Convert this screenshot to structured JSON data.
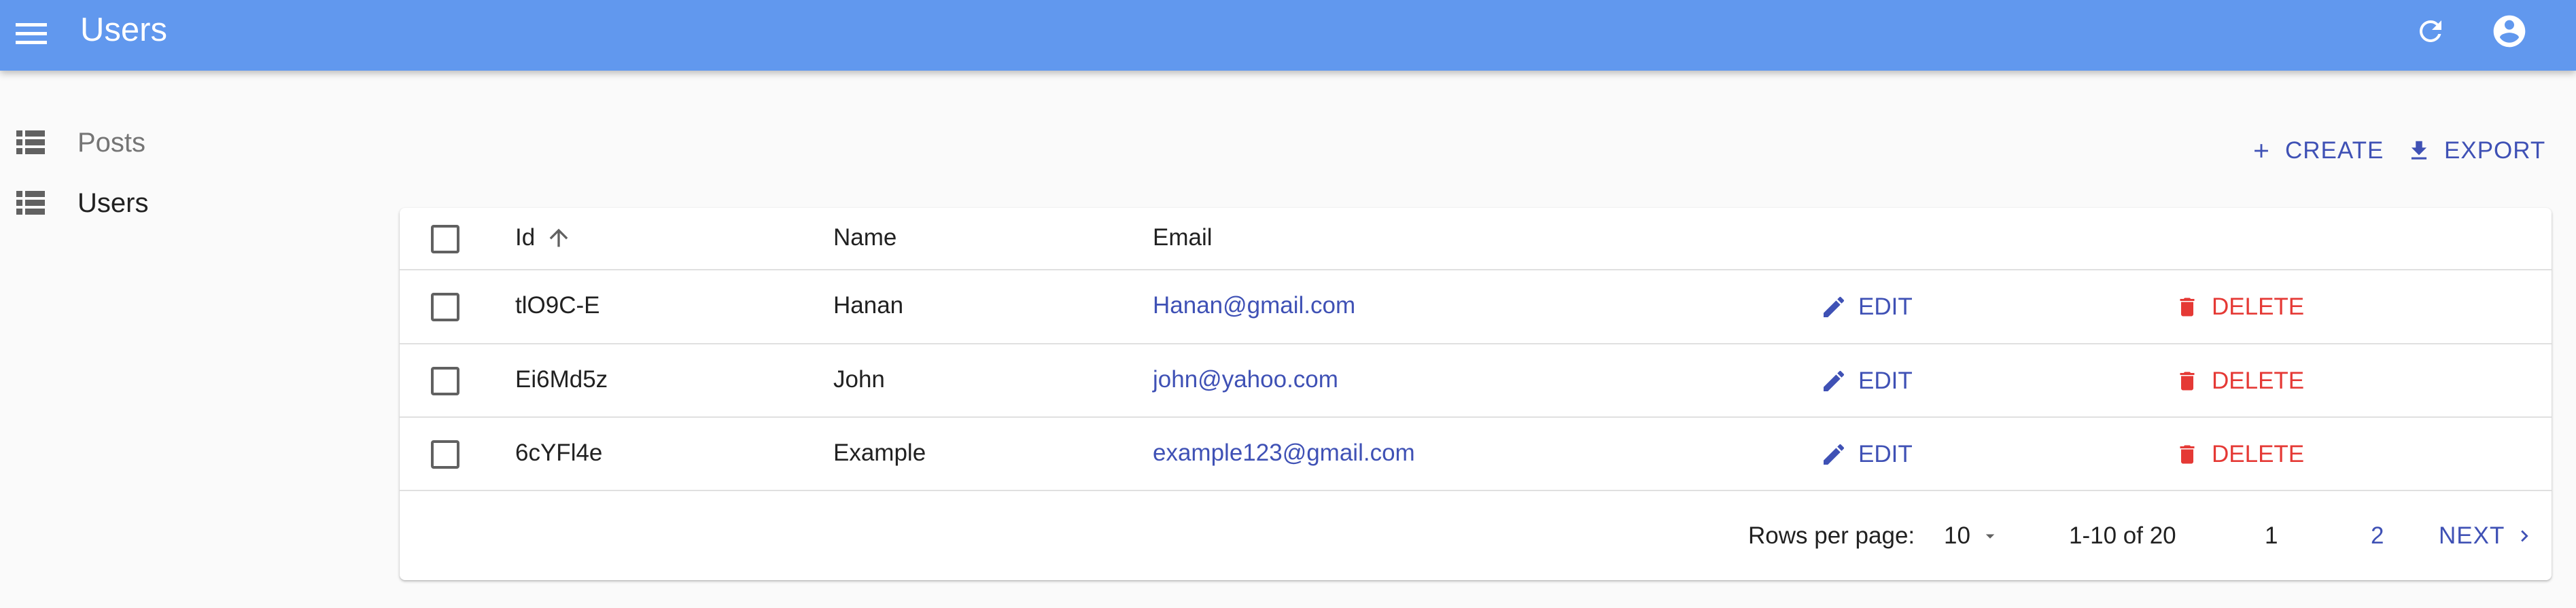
{
  "appbar": {
    "title": "Users",
    "color": "#6198ee",
    "menu_icon": "menu-icon",
    "refresh_icon": "refresh-icon",
    "account_icon": "account-circle-icon"
  },
  "sidebar": {
    "items": [
      {
        "label": "Posts",
        "icon": "list-icon",
        "active": false
      },
      {
        "label": "Users",
        "icon": "list-icon",
        "active": true
      }
    ]
  },
  "toolbar": {
    "create_label": "CREATE",
    "export_label": "EXPORT",
    "accent": "#3f51b5"
  },
  "table": {
    "columns": [
      "Id",
      "Name",
      "Email"
    ],
    "sort": {
      "column": "Id",
      "direction": "ascending"
    },
    "rows": [
      {
        "id": "tlO9C-E",
        "name": "Hanan",
        "email": "Hanan@gmail.com",
        "edit": "EDIT",
        "delete": "DELETE"
      },
      {
        "id": "Ei6Md5z",
        "name": "John",
        "email": "john@yahoo.com",
        "edit": "EDIT",
        "delete": "DELETE"
      },
      {
        "id": "6cYFl4e",
        "name": "Example",
        "email": "example123@gmail.com",
        "edit": "EDIT",
        "delete": "DELETE"
      }
    ],
    "delete_color": "#e53935"
  },
  "pagination": {
    "rows_per_page_label": "Rows per page:",
    "rows_per_page": "10",
    "range": "1-10 of 20",
    "pages": [
      "1",
      "2"
    ],
    "current_page": "1",
    "next_label": "NEXT"
  }
}
